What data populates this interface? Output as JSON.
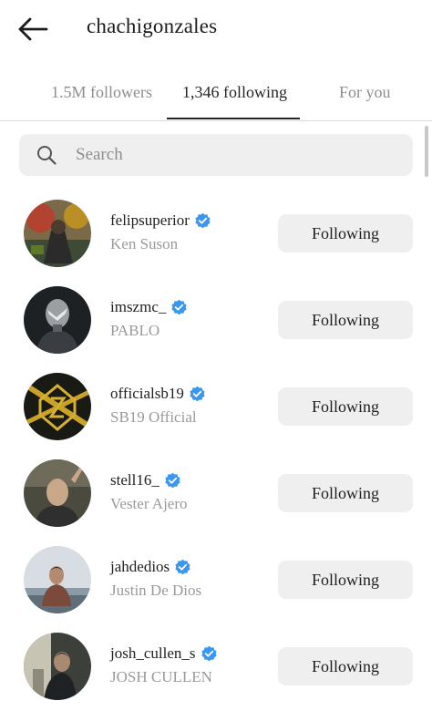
{
  "header": {
    "title": "chachigonzales",
    "back_icon": "arrow-left-icon"
  },
  "tabs": [
    {
      "label": "1.5M followers",
      "active": false
    },
    {
      "label": "1,346 following",
      "active": true
    },
    {
      "label": "For you",
      "active": false
    }
  ],
  "search": {
    "placeholder": "Search",
    "value": ""
  },
  "colors": {
    "verified": "#3897f0",
    "button_bg": "#efefef",
    "secondary_text": "#9a9a9a"
  },
  "accounts": [
    {
      "username": "felipsuperior",
      "full_name": "Ken Suson",
      "verified": true,
      "button": "Following"
    },
    {
      "username": "imszmc_",
      "full_name": "PABLO",
      "verified": true,
      "button": "Following"
    },
    {
      "username": "officialsb19",
      "full_name": "SB19 Official",
      "verified": true,
      "button": "Following"
    },
    {
      "username": "stell16_",
      "full_name": "Vester Ajero",
      "verified": true,
      "button": "Following"
    },
    {
      "username": "jahdedios",
      "full_name": "Justin De Dios",
      "verified": true,
      "button": "Following"
    },
    {
      "username": "josh_cullen_s",
      "full_name": "JOSH CULLEN",
      "verified": true,
      "button": "Following"
    }
  ]
}
